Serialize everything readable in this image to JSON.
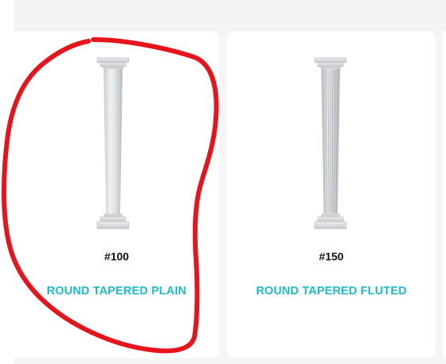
{
  "products": [
    {
      "sku": "#100",
      "name": "ROUND TAPERED PLAIN"
    },
    {
      "sku": "#150",
      "name": "ROUND TAPERED FLUTED"
    }
  ],
  "colors": {
    "product_name": "#1bbccc",
    "annotation": "#e8141b",
    "card": "#ffffff",
    "page_background": "#f5f5f5"
  },
  "icons": {
    "plain_column": "round-tapered-plain-column-icon",
    "fluted_column": "round-tapered-fluted-column-icon"
  }
}
